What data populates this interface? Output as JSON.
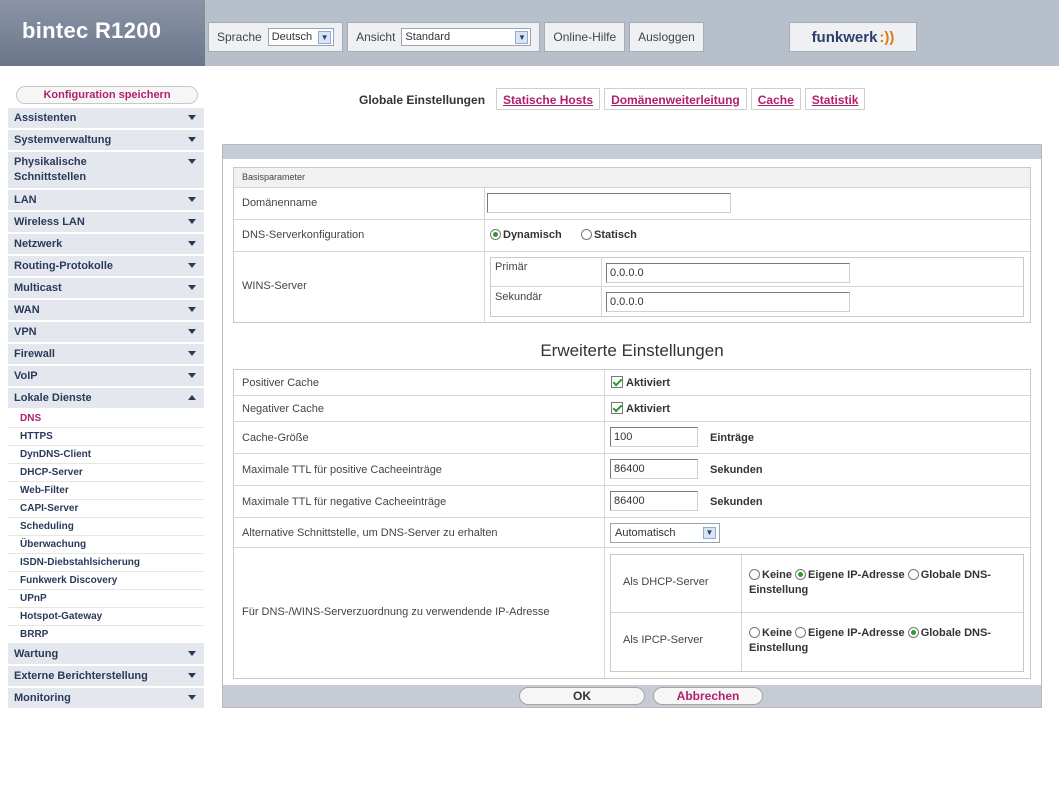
{
  "header": {
    "title": "bintec R1200",
    "language_label": "Sprache",
    "language_value": "Deutsch",
    "view_label": "Ansicht",
    "view_value": "Standard",
    "help_label": "Online-Hilfe",
    "logout_label": "Ausloggen",
    "logo_text": "funkwerk"
  },
  "sidebar": {
    "save_label": "Konfiguration speichern",
    "items": [
      {
        "label": "Assistenten"
      },
      {
        "label": "Systemverwaltung"
      },
      {
        "label": "Physikalische Schnittstellen"
      },
      {
        "label": "LAN"
      },
      {
        "label": "Wireless LAN"
      },
      {
        "label": "Netzwerk"
      },
      {
        "label": "Routing-Protokolle"
      },
      {
        "label": "Multicast"
      },
      {
        "label": "WAN"
      },
      {
        "label": "VPN"
      },
      {
        "label": "Firewall"
      },
      {
        "label": "VoIP"
      },
      {
        "label": "Lokale Dienste"
      }
    ],
    "sub_items": [
      "DNS",
      "HTTPS",
      "DynDNS-Client",
      "DHCP-Server",
      "Web-Filter",
      "CAPI-Server",
      "Scheduling",
      "Überwachung",
      "ISDN-Diebstahlsicherung",
      "Funkwerk Discovery",
      "UPnP",
      "Hotspot-Gateway",
      "BRRP"
    ],
    "bottom_items": [
      {
        "label": "Wartung"
      },
      {
        "label": "Externe Berichterstellung"
      },
      {
        "label": "Monitoring"
      }
    ]
  },
  "tabs": [
    "Globale Einstellungen",
    "Statische Hosts",
    "Domänenweiterleitung",
    "Cache",
    "Statistik"
  ],
  "basis": {
    "header": "Basisparameter",
    "domain_label": "Domänenname",
    "domain_value": "",
    "dns_config_label": "DNS-Serverkonfiguration",
    "dns_option_dynamic": "Dynamisch",
    "dns_option_static": "Statisch",
    "dns_selected": "Dynamisch",
    "wins_label": "WINS-Server",
    "primary_label": "Primär",
    "primary_value": "0.0.0.0",
    "secondary_label": "Sekundär",
    "secondary_value": "0.0.0.0"
  },
  "advanced": {
    "title": "Erweiterte Einstellungen",
    "positive_cache_label": "Positiver Cache",
    "positive_cache_option": "Aktiviert",
    "positive_cache_checked": true,
    "negative_cache_label": "Negativer Cache",
    "negative_cache_option": "Aktiviert",
    "negative_cache_checked": true,
    "cache_size_label": "Cache-Größe",
    "cache_size_value": "100",
    "cache_size_unit": "Einträge",
    "max_ttl_pos_label": "Maximale TTL für positive Cacheeinträge",
    "max_ttl_pos_value": "86400",
    "max_ttl_pos_unit": "Sekunden",
    "max_ttl_neg_label": "Maximale TTL für negative Cacheeinträge",
    "max_ttl_neg_value": "86400",
    "max_ttl_neg_unit": "Sekunden",
    "alt_iface_label": "Alternative Schnittstelle, um DNS-Server zu erhalten",
    "alt_iface_value": "Automatisch",
    "assign_label": "Für DNS-/WINS-Serverzuordnung zu verwendende IP-Adresse",
    "dhcp_server_label": "Als DHCP-Server",
    "ipcp_server_label": "Als IPCP-Server",
    "opt_none": "Keine",
    "opt_own_ip": "Eigene IP-Adresse",
    "opt_global": "Globale DNS-Einstellung",
    "dhcp_selected": "Eigene IP-Adresse",
    "ipcp_selected": "Globale DNS-Einstellung"
  },
  "buttons": {
    "ok": "OK",
    "cancel": "Abbrechen"
  },
  "colors": {
    "accent": "#b0206e",
    "nav_bg": "#e4e8ee",
    "header_bg": "#b7bfcb",
    "radio_selected": "#2e9a2e"
  }
}
